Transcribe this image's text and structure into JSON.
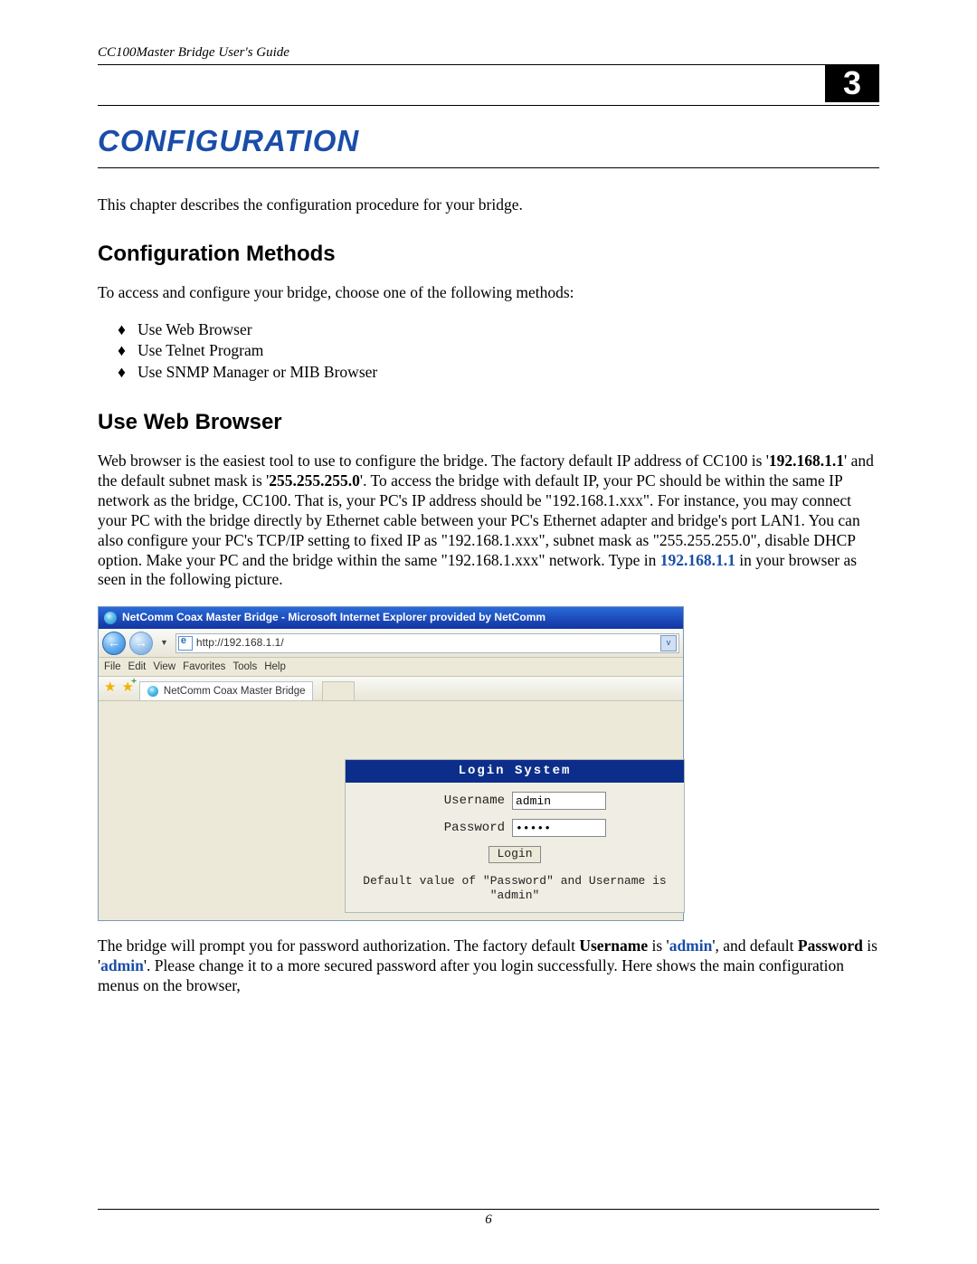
{
  "doc_header": "CC100Master Bridge User's Guide",
  "chapter_number": "3",
  "chapter_title": "CONFIGURATION",
  "intro": "This chapter describes the configuration procedure for your bridge.",
  "section_methods": {
    "heading": "Configuration Methods",
    "lead": "To access and configure your bridge, choose one of the following methods:",
    "items": [
      "Use Web Browser",
      "Use Telnet Program",
      "Use SNMP Manager or MIB Browser"
    ]
  },
  "section_web": {
    "heading": "Use Web Browser",
    "para_parts": {
      "a": "Web browser is the easiest tool to use to configure the bridge. The factory default IP address of CC100 is '",
      "ip": "192.168.1.1",
      "b": "' and the default subnet mask is '",
      "mask": "255.255.255.0",
      "c": "'. To access the bridge with default IP, your PC should be within the same IP network as the bridge, CC100. That is, your PC's IP address should be \"192.168.1.xxx\". For instance, you may connect your PC with the bridge directly by Ethernet cable between your PC's Ethernet adapter and bridge's port LAN1. You can also configure your PC's TCP/IP setting to fixed IP as \"192.168.1.xxx\", subnet mask as \"255.255.255.0\", disable DHCP option. Make your PC and the bridge within the same \"192.168.1.xxx\" network. Type in ",
      "ip2": "192.168.1.1",
      "d": " in your browser as seen in the following picture."
    }
  },
  "ie": {
    "title": "NetComm Coax Master Bridge - Microsoft Internet Explorer provided by NetComm",
    "url": "http://192.168.1.1/",
    "menu": [
      "File",
      "Edit",
      "View",
      "Favorites",
      "Tools",
      "Help"
    ],
    "tab": "NetComm Coax Master Bridge",
    "back_glyph": "←",
    "fwd_glyph": "→",
    "login": {
      "title": "Login System",
      "username_label": "Username",
      "username_value": "admin",
      "password_label": "Password",
      "password_value": "•••••",
      "button": "Login",
      "hint": "Default value of \"Password\" and Username is \"admin\""
    }
  },
  "after_ss": {
    "p1a": "The bridge will prompt you for password authorization. The factory default ",
    "u": "Username",
    "p1b": " is '",
    "admin1": "admin",
    "p1c": "', and default ",
    "pw": "Password",
    "p1d": " is '",
    "admin2": "admin",
    "p1e": "'. Please change it to a more secured password after you login successfully. Here shows the main configuration menus on the browser,"
  },
  "page_number": "6"
}
